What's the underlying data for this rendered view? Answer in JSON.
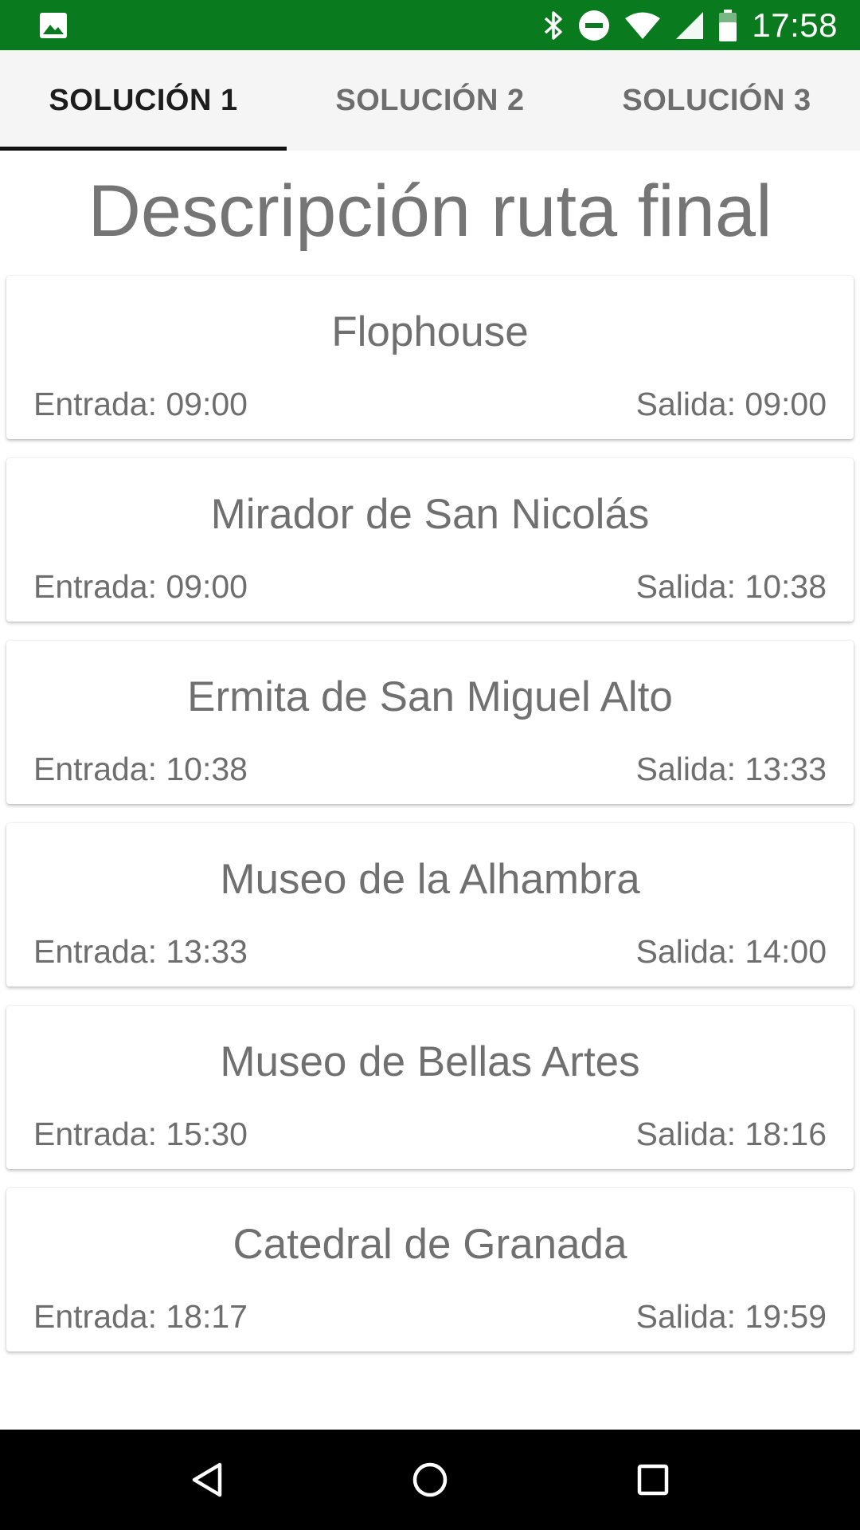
{
  "status_bar": {
    "time": "17:58",
    "icons": [
      "image-icon",
      "bluetooth-icon",
      "do-not-disturb-icon",
      "wifi-icon",
      "signal-icon",
      "battery-icon"
    ],
    "background": "#0a7a1e"
  },
  "tabs": [
    {
      "label": "SOLUCIÓN 1",
      "active": true
    },
    {
      "label": "SOLUCIÓN 2",
      "active": false
    },
    {
      "label": "SOLUCIÓN 3",
      "active": false
    }
  ],
  "title": "Descripción ruta final",
  "stops": [
    {
      "name": "Flophouse",
      "entrada": "Entrada: 09:00",
      "salida": "Salida: 09:00"
    },
    {
      "name": "Mirador de San Nicolás",
      "entrada": "Entrada: 09:00",
      "salida": "Salida: 10:38"
    },
    {
      "name": "Ermita de San Miguel Alto",
      "entrada": "Entrada: 10:38",
      "salida": "Salida: 13:33"
    },
    {
      "name": "Museo de la Alhambra",
      "entrada": "Entrada: 13:33",
      "salida": "Salida: 14:00"
    },
    {
      "name": "Museo de Bellas Artes",
      "entrada": "Entrada: 15:30",
      "salida": "Salida: 18:16"
    },
    {
      "name": "Catedral de Granada",
      "entrada": "Entrada: 18:17",
      "salida": "Salida: 19:59"
    }
  ],
  "nav_bar": {
    "icons": [
      "back-icon",
      "home-icon",
      "recents-icon"
    ]
  }
}
